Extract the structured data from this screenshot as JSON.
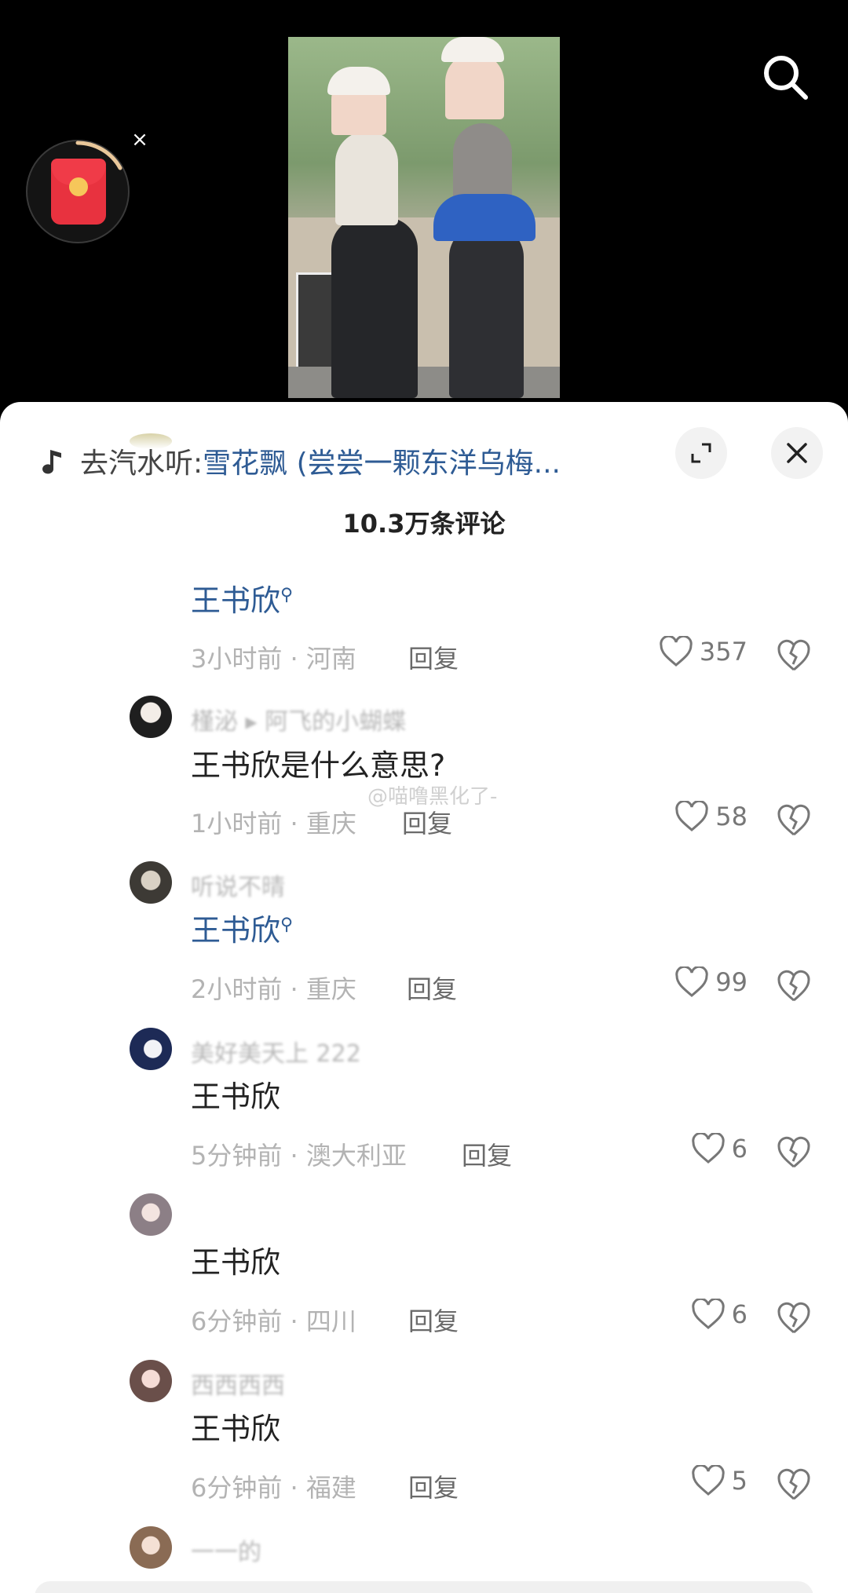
{
  "music": {
    "prefix": "去汽水听:",
    "song": " 雪花飘 (尝尝一颗东洋乌梅..."
  },
  "comments_count": "10.3万条评论",
  "watermark": "@喵噜黑化了-",
  "comments": [
    {
      "username": "",
      "text": "王书欣",
      "search_hint": true,
      "time": "3小时前",
      "location": "河南",
      "reply": "回复",
      "likes": "357"
    },
    {
      "username": "槿泌 ▸ 阿飞的小蝴蝶",
      "text": "王书欣是什么意思?",
      "search_hint": false,
      "time": "1小时前",
      "location": "重庆",
      "reply": "回复",
      "likes": "58"
    },
    {
      "username": "听说不晴",
      "text": "王书欣",
      "search_hint": true,
      "time": "2小时前",
      "location": "重庆",
      "reply": "回复",
      "likes": "99"
    },
    {
      "username": "美好美天上 222",
      "text": "王书欣",
      "search_hint": false,
      "time": "5分钟前",
      "location": "澳大利亚",
      "reply": "回复",
      "likes": "6"
    },
    {
      "username": "",
      "text": "王书欣",
      "search_hint": false,
      "time": "6分钟前",
      "location": "四川",
      "reply": "回复",
      "likes": "6"
    },
    {
      "username": "西西西西",
      "text": "王书欣",
      "search_hint": false,
      "time": "6分钟前",
      "location": "福建",
      "reply": "回复",
      "likes": "5"
    },
    {
      "username": "一一的",
      "text": "",
      "search_hint": false,
      "time": "",
      "location": "",
      "reply": "",
      "likes": ""
    }
  ],
  "colors": {
    "link": "#2e5b94",
    "red_packet": "#e8323f"
  },
  "icons": [
    "search-icon",
    "red-packet-icon",
    "close-icon",
    "music-note-icon",
    "expand-icon",
    "heart-icon",
    "broken-heart-icon"
  ]
}
